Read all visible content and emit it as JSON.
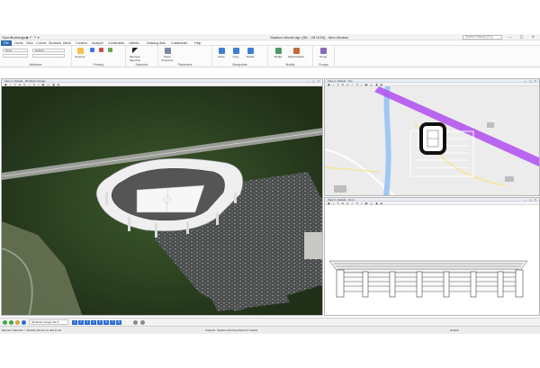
{
  "app": {
    "title_left": "OpenBuildings",
    "quick_access": "▫ ◆ ↶ ↷ ▾",
    "window_title": "Stadium Model.dgn [3D - V8 DGN] - MicroStation",
    "search_placeholder": "Search Ribbon (F4)",
    "window_controls": "— ▢ ✕"
  },
  "menu": {
    "tabs": [
      "File",
      "Home",
      "View",
      "Curves",
      "Surfaces",
      "Mesh",
      "Content",
      "Analyze",
      "Constraints",
      "Utilities",
      "Drawing Aids",
      "Collaborate",
      "Help"
    ]
  },
  "ribbon": {
    "groups": [
      {
        "label": "Attributes"
      },
      {
        "label": "Primary"
      },
      {
        "label": "Selection"
      },
      {
        "label": "Placement"
      },
      {
        "label": "Manipulate"
      },
      {
        "label": "Modify"
      },
      {
        "label": "Groups"
      }
    ],
    "level_value": "Default",
    "attribute_value": "None",
    "buttons": {
      "explorer": "Explorer",
      "element_selection": "Element Selection",
      "place_smartline": "Place SmartLine",
      "move": "Move",
      "copy": "Copy",
      "rotate": "Rotate",
      "modify": "Modify",
      "partial_delete": "Partial Delete",
      "group": "Group"
    }
  },
  "views": {
    "view1": {
      "title": "View 1, Default - 3D Metric Design"
    },
    "view2": {
      "title": "View 2, Default - Top"
    },
    "view3": {
      "title": "View 3, Default - Front"
    },
    "tools_glyphs": "▣ ◐ ✎ ⊕ ⊖ ⤢ ⟲ ⌖ ▦ ◫ ◨ ▤",
    "controls": "— ▢ ✕"
  },
  "navbar": {
    "model_combo": "3D Metric Design Mo ▾",
    "view_numbers": [
      "1",
      "2",
      "3",
      "4",
      "5",
      "6",
      "7",
      "8"
    ]
  },
  "status": {
    "left": "Element Selection > Identify element to add to set",
    "middle": "Analysis: 'Stadium Roofing Mesh 01' loaded",
    "right": "Default"
  },
  "colors": {
    "accent": "#2c6bd6",
    "road_purple": "#b24ef0",
    "river_blue": "#9ec8f2"
  }
}
